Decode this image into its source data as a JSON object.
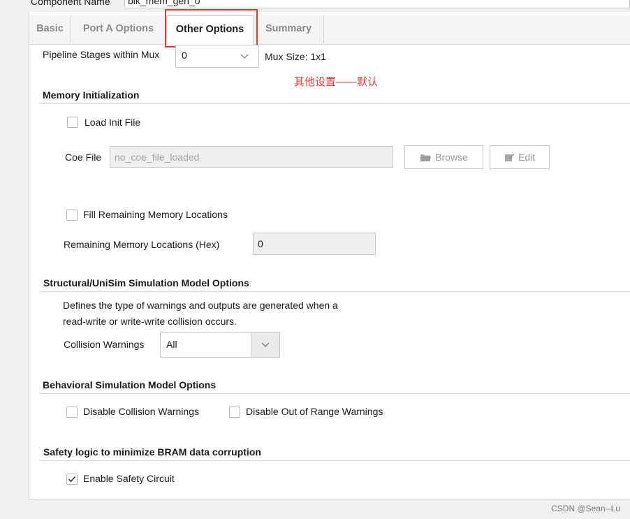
{
  "header": {
    "component_name_label": "Component Name",
    "component_name_value": "blk_mem_gen_0"
  },
  "tabs": [
    {
      "label": "Basic",
      "active": false
    },
    {
      "label": "Port A Options",
      "active": false
    },
    {
      "label": "Other Options",
      "active": true
    },
    {
      "label": "Summary",
      "active": false
    }
  ],
  "annotation_note": "其他设置——默认",
  "pipeline": {
    "label": "Pipeline Stages within Mux",
    "value": "0",
    "mux_size": "Mux Size: 1x1"
  },
  "memory_init": {
    "title": "Memory Initialization",
    "load_init_file": {
      "label": "Load Init File",
      "checked": false
    },
    "coe_label": "Coe File",
    "coe_value": "no_coe_file_loaded",
    "browse_label": "Browse",
    "edit_label": "Edit",
    "fill_remaining": {
      "label": "Fill Remaining Memory Locations",
      "checked": false
    },
    "remaining_label": "Remaining Memory Locations (Hex)",
    "remaining_value": "0"
  },
  "structural": {
    "title": "Structural/UniSim Simulation Model Options",
    "description_line1": "Defines the type of warnings and outputs are generated when a",
    "description_line2": "read-write or write-write collision occurs.",
    "collision_label": "Collision Warnings",
    "collision_value": "All"
  },
  "behavioral": {
    "title": "Behavioral Simulation Model Options",
    "disable_collision": {
      "label": "Disable Collision Warnings",
      "checked": false
    },
    "disable_out_of_range": {
      "label": "Disable Out of Range Warnings",
      "checked": false
    }
  },
  "safety": {
    "title": "Safety logic to minimize BRAM data corruption",
    "enable_safety": {
      "label": "Enable Safety Circuit",
      "checked": true
    }
  },
  "watermark": "CSDN @Sean--Lu",
  "colors": {
    "annotation_red": "#e53935",
    "panel_bg": "#ffffff",
    "window_bg": "#f0f0f0"
  }
}
